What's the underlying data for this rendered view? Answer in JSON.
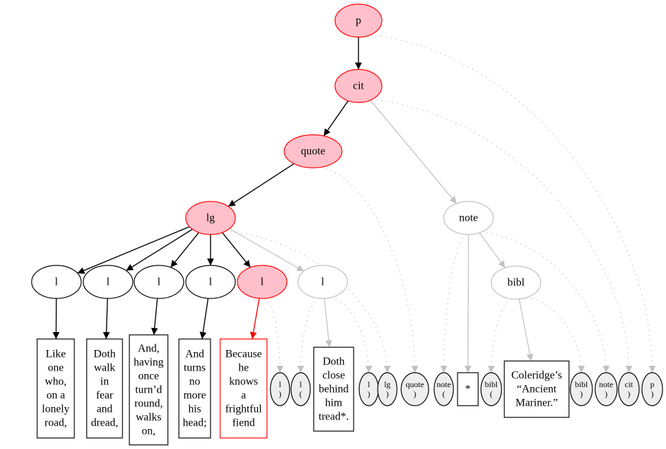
{
  "diagram": {
    "type": "tree",
    "colors": {
      "highlight_fill": "#ffc0cb",
      "highlight_stroke": "#ff0000",
      "active_stroke": "#000000",
      "inactive_stroke": "#c0c0c0",
      "marker_fill": "#eeeeee"
    },
    "nodes": [
      {
        "id": "p",
        "label": "p",
        "shape": "ellipse",
        "state": "highlight"
      },
      {
        "id": "cit",
        "label": "cit",
        "shape": "ellipse",
        "state": "highlight"
      },
      {
        "id": "quote",
        "label": "quote",
        "shape": "ellipse",
        "state": "highlight"
      },
      {
        "id": "lg",
        "label": "lg",
        "shape": "ellipse",
        "state": "highlight"
      },
      {
        "id": "l1",
        "label": "l",
        "shape": "ellipse",
        "state": "active"
      },
      {
        "id": "l2",
        "label": "l",
        "shape": "ellipse",
        "state": "active"
      },
      {
        "id": "l3",
        "label": "l",
        "shape": "ellipse",
        "state": "active"
      },
      {
        "id": "l4",
        "label": "l",
        "shape": "ellipse",
        "state": "active"
      },
      {
        "id": "l5",
        "label": "l",
        "shape": "ellipse",
        "state": "highlight"
      },
      {
        "id": "l6",
        "label": "l",
        "shape": "ellipse",
        "state": "inactive"
      },
      {
        "id": "note",
        "label": "note",
        "shape": "ellipse",
        "state": "inactive"
      },
      {
        "id": "bibl",
        "label": "bibl",
        "shape": "ellipse",
        "state": "inactive"
      },
      {
        "id": "t1",
        "label": [
          "Like",
          "one",
          "who,",
          "on a",
          "lonely",
          "road,"
        ],
        "shape": "box",
        "state": "active"
      },
      {
        "id": "t2",
        "label": [
          "Doth",
          "walk",
          "in",
          "fear",
          "and",
          "dread,"
        ],
        "shape": "box",
        "state": "active"
      },
      {
        "id": "t3",
        "label": [
          "And,",
          "having",
          "once",
          "turn’d",
          "round,",
          "walks",
          "on,"
        ],
        "shape": "box",
        "state": "active"
      },
      {
        "id": "t4",
        "label": [
          "And",
          "turns",
          "no",
          "more",
          "his",
          "head;"
        ],
        "shape": "box",
        "state": "active"
      },
      {
        "id": "t5",
        "label": [
          "Because",
          "he",
          "knows",
          "a",
          "frightful",
          "fiend"
        ],
        "shape": "box",
        "state": "highlight"
      },
      {
        "id": "m1",
        "label": [
          "l",
          ")"
        ],
        "shape": "marker"
      },
      {
        "id": "m2",
        "label": [
          "l",
          "("
        ],
        "shape": "marker"
      },
      {
        "id": "t6",
        "label": [
          "Doth",
          "close",
          "behind",
          "him",
          "tread*."
        ],
        "shape": "box",
        "state": "active"
      },
      {
        "id": "m3",
        "label": [
          "l",
          ")"
        ],
        "shape": "marker"
      },
      {
        "id": "m4",
        "label": [
          "lg",
          ")"
        ],
        "shape": "marker"
      },
      {
        "id": "m5",
        "label": [
          "quote",
          ")"
        ],
        "shape": "marker"
      },
      {
        "id": "m6",
        "label": [
          "note",
          "("
        ],
        "shape": "marker"
      },
      {
        "id": "t7",
        "label": [
          "*"
        ],
        "shape": "box",
        "state": "active"
      },
      {
        "id": "m7",
        "label": [
          "bibl",
          "("
        ],
        "shape": "marker"
      },
      {
        "id": "t8",
        "label": [
          "Coleridge’s",
          "“Ancient",
          "Mariner.”"
        ],
        "shape": "box",
        "state": "active"
      },
      {
        "id": "m8",
        "label": [
          "bibl",
          ")"
        ],
        "shape": "marker"
      },
      {
        "id": "m9",
        "label": [
          "note",
          ")"
        ],
        "shape": "marker"
      },
      {
        "id": "m10",
        "label": [
          "cit",
          ")"
        ],
        "shape": "marker"
      },
      {
        "id": "m11",
        "label": [
          "p",
          ")"
        ],
        "shape": "marker"
      }
    ],
    "edges": [
      {
        "from": "p",
        "to": "cit",
        "style": "active"
      },
      {
        "from": "cit",
        "to": "quote",
        "style": "active"
      },
      {
        "from": "quote",
        "to": "lg",
        "style": "active"
      },
      {
        "from": "lg",
        "to": "l1",
        "style": "active"
      },
      {
        "from": "lg",
        "to": "l2",
        "style": "active"
      },
      {
        "from": "lg",
        "to": "l3",
        "style": "active"
      },
      {
        "from": "lg",
        "to": "l4",
        "style": "active"
      },
      {
        "from": "lg",
        "to": "l5",
        "style": "active"
      },
      {
        "from": "lg",
        "to": "l6",
        "style": "inactive"
      },
      {
        "from": "cit",
        "to": "note",
        "style": "inactive"
      },
      {
        "from": "note",
        "to": "bibl",
        "style": "inactive"
      },
      {
        "from": "l1",
        "to": "t1",
        "style": "active"
      },
      {
        "from": "l2",
        "to": "t2",
        "style": "active"
      },
      {
        "from": "l3",
        "to": "t3",
        "style": "active"
      },
      {
        "from": "l4",
        "to": "t4",
        "style": "active"
      },
      {
        "from": "l5",
        "to": "t5",
        "style": "highlight"
      },
      {
        "from": "l5",
        "to": "m1",
        "style": "dotted"
      },
      {
        "from": "l6",
        "to": "m2",
        "style": "dotted"
      },
      {
        "from": "l6",
        "to": "t6",
        "style": "inactive"
      },
      {
        "from": "l6",
        "to": "m3",
        "style": "dotted"
      },
      {
        "from": "lg",
        "to": "m4",
        "style": "dotted"
      },
      {
        "from": "quote",
        "to": "m5",
        "style": "dotted"
      },
      {
        "from": "note",
        "to": "m6",
        "style": "dotted"
      },
      {
        "from": "note",
        "to": "t7",
        "style": "inactive"
      },
      {
        "from": "bibl",
        "to": "m7",
        "style": "dotted"
      },
      {
        "from": "bibl",
        "to": "t8",
        "style": "inactive"
      },
      {
        "from": "bibl",
        "to": "m8",
        "style": "dotted"
      },
      {
        "from": "note",
        "to": "m9",
        "style": "dotted"
      },
      {
        "from": "cit",
        "to": "m10",
        "style": "dotted"
      },
      {
        "from": "p",
        "to": "m11",
        "style": "dotted"
      }
    ]
  }
}
